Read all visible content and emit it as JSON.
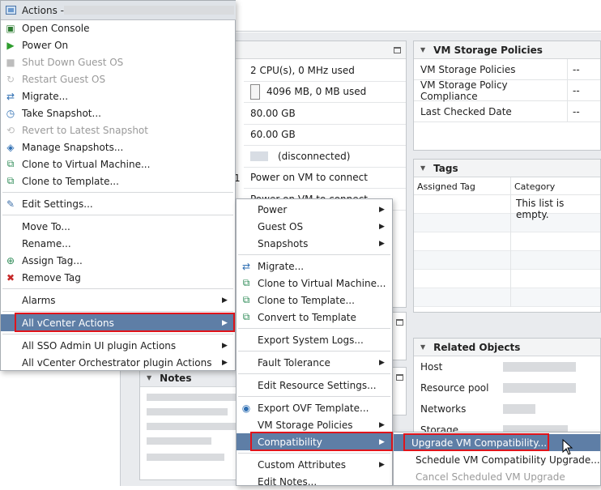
{
  "actions_menu": {
    "title_prefix": "Actions - ",
    "items": [
      {
        "label": "Open Console",
        "icon": "console-icon",
        "disabled": false
      },
      {
        "label": "Power On",
        "icon": "power-on-icon",
        "disabled": false
      },
      {
        "label": "Shut Down Guest OS",
        "icon": "shutdown-icon",
        "disabled": true
      },
      {
        "label": "Restart Guest OS",
        "icon": "restart-icon",
        "disabled": true
      },
      {
        "label": "Migrate...",
        "icon": "migrate-icon",
        "disabled": false
      },
      {
        "label": "Take Snapshot...",
        "icon": "snapshot-icon",
        "disabled": false
      },
      {
        "label": "Revert to Latest Snapshot",
        "icon": "revert-icon",
        "disabled": true
      },
      {
        "label": "Manage Snapshots...",
        "icon": "manage-snapshots-icon",
        "disabled": false
      },
      {
        "label": "Clone to Virtual Machine...",
        "icon": "clone-vm-icon",
        "disabled": false
      },
      {
        "label": "Clone to Template...",
        "icon": "clone-template-icon",
        "disabled": false
      },
      {
        "label": "Edit Settings...",
        "icon": "edit-settings-icon",
        "disabled": false
      },
      {
        "label": "Move To...",
        "icon": "",
        "disabled": false
      },
      {
        "label": "Rename...",
        "icon": "",
        "disabled": false
      },
      {
        "label": "Assign Tag...",
        "icon": "assign-tag-icon",
        "disabled": false
      },
      {
        "label": "Remove Tag",
        "icon": "remove-tag-icon",
        "disabled": false
      },
      {
        "label": "Alarms",
        "icon": "",
        "disabled": false,
        "submenu": true
      },
      {
        "label": "All vCenter Actions",
        "icon": "",
        "disabled": false,
        "submenu": true,
        "selected": true
      },
      {
        "label": "All SSO Admin UI plugin Actions",
        "icon": "",
        "disabled": false,
        "submenu": true
      },
      {
        "label": "All vCenter Orchestrator plugin Actions",
        "icon": "",
        "disabled": false,
        "submenu": true
      }
    ]
  },
  "vcenter_submenu": {
    "items": [
      {
        "label": "Power",
        "submenu": true
      },
      {
        "label": "Guest OS",
        "submenu": true
      },
      {
        "label": "Snapshots",
        "submenu": true
      },
      {
        "label": "Migrate...",
        "icon": "migrate-icon"
      },
      {
        "label": "Clone to Virtual Machine...",
        "icon": "clone-vm-icon"
      },
      {
        "label": "Clone to Template...",
        "icon": "clone-template-icon"
      },
      {
        "label": "Convert to Template",
        "icon": "convert-template-icon"
      },
      {
        "label": "Export System Logs..."
      },
      {
        "label": "Fault Tolerance",
        "submenu": true
      },
      {
        "label": "Edit Resource Settings..."
      },
      {
        "label": "Export OVF Template...",
        "icon": "export-ovf-icon"
      },
      {
        "label": "VM Storage Policies",
        "submenu": true
      },
      {
        "label": "Compatibility",
        "submenu": true,
        "selected": true
      },
      {
        "label": "Custom Attributes",
        "submenu": true
      },
      {
        "label": "Edit Notes..."
      }
    ]
  },
  "compat_submenu": {
    "items": [
      {
        "label": "Upgrade VM Compatibility...",
        "selected": true,
        "disabled": false
      },
      {
        "label": "Schedule VM Compatibility Upgrade...",
        "disabled": false
      },
      {
        "label": "Cancel Scheduled VM Upgrade",
        "disabled": true
      }
    ]
  },
  "hardware_panel": {
    "rows": [
      "2 CPU(s), 0 MHz used",
      "4096 MB, 0 MB used",
      "80.00 GB",
      "60.00 GB",
      "(disconnected)",
      "Power on VM to connect",
      "Power on VM to connect"
    ],
    "row_left_digit": "1"
  },
  "storage_policies": {
    "title": "VM Storage Policies",
    "rows": [
      {
        "label": "VM Storage Policies",
        "value": "--"
      },
      {
        "label": "VM Storage Policy Compliance",
        "value": "--"
      },
      {
        "label": "Last Checked Date",
        "value": "--"
      }
    ]
  },
  "tags": {
    "title": "Tags",
    "col_assigned": "Assigned Tag",
    "col_category": "Category",
    "empty_text": "This list is empty."
  },
  "related_objects": {
    "title": "Related Objects",
    "rows": [
      "Host",
      "Resource pool",
      "Networks",
      "Storage"
    ]
  },
  "notes": {
    "title": "Notes"
  },
  "colors": {
    "selection": "#5e7ea6",
    "highlight_box": "#e0141b"
  }
}
